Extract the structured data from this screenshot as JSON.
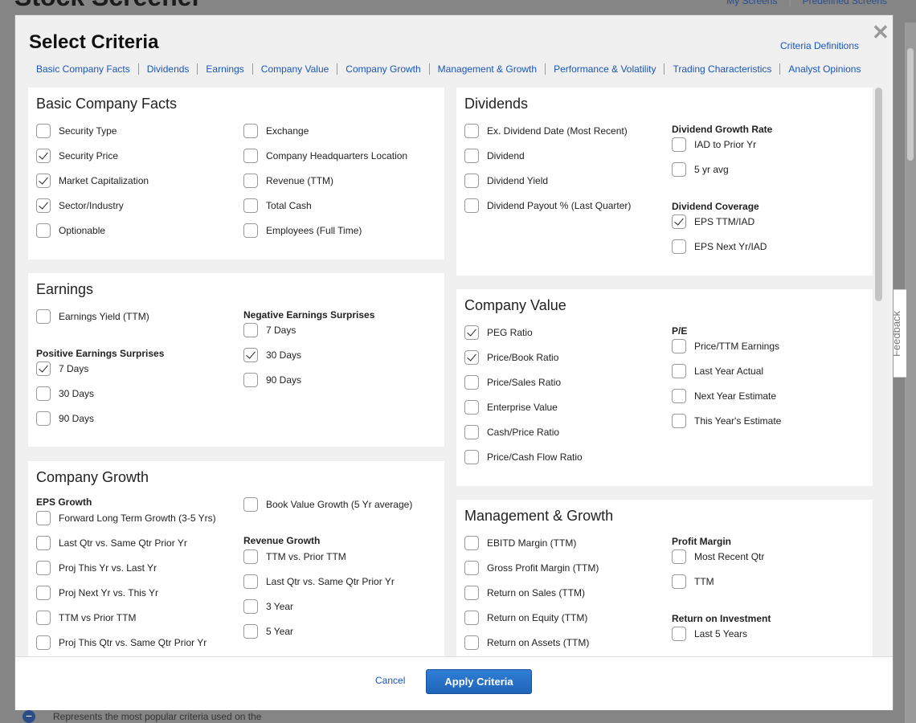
{
  "background": {
    "page_title": "Stock Screener",
    "my_screens": "My Screens",
    "predefined_screens": "Predefined Screens",
    "bottom_text": "Represents the most popular criteria used on the"
  },
  "feedback": {
    "label": "Feedback"
  },
  "modal": {
    "title": "Select Criteria",
    "close_icon": "✕",
    "criteria_definitions": "Criteria Definitions",
    "nav": [
      "Basic Company Facts",
      "Dividends",
      "Earnings",
      "Company Value",
      "Company Growth",
      "Management & Growth",
      "Performance & Volatility",
      "Trading Characteristics",
      "Analyst Opinions"
    ]
  },
  "panels": {
    "basic": {
      "title": "Basic Company Facts",
      "items": [
        {
          "label": "Security Type",
          "checked": false
        },
        {
          "label": "Security Price",
          "checked": true
        },
        {
          "label": "Market Capitalization",
          "checked": true
        },
        {
          "label": "Sector/Industry",
          "checked": true
        },
        {
          "label": "Optionable",
          "checked": false
        },
        {
          "label": "Exchange",
          "checked": false
        },
        {
          "label": "Company Headquarters Location",
          "checked": false
        },
        {
          "label": "Revenue (TTM)",
          "checked": false
        },
        {
          "label": "Total Cash",
          "checked": false
        },
        {
          "label": "Employees (Full Time)",
          "checked": false
        }
      ]
    },
    "dividends": {
      "title": "Dividends",
      "items": [
        {
          "label": "Ex. Dividend Date (Most Recent)",
          "checked": false
        },
        {
          "label": "Dividend",
          "checked": false
        },
        {
          "label": "Dividend Yield",
          "checked": false
        },
        {
          "label": "Dividend Payout % (Last Quarter)",
          "checked": false
        },
        {
          "label": "IAD to Prior Yr",
          "checked": false
        },
        {
          "label": "5 yr avg",
          "checked": false
        },
        {
          "label": "EPS TTM/IAD",
          "checked": true
        },
        {
          "label": "EPS Next Yr/IAD",
          "checked": false
        }
      ],
      "sub_growth": "Dividend Growth Rate",
      "sub_coverage": "Dividend Coverage"
    },
    "earnings": {
      "title": "Earnings",
      "items": [
        {
          "label": "Earnings Yield (TTM)",
          "checked": false
        },
        {
          "label": "7 Days",
          "checked": true
        },
        {
          "label": "30 Days",
          "checked": false
        },
        {
          "label": "90 Days",
          "checked": false
        },
        {
          "label": "7 Days",
          "checked": false
        },
        {
          "label": "30 Days",
          "checked": true
        },
        {
          "label": "90 Days",
          "checked": false
        }
      ],
      "sub_positive": "Positive Earnings Surprises",
      "sub_negative": "Negative Earnings Surprises"
    },
    "value": {
      "title": "Company Value",
      "items": [
        {
          "label": "PEG Ratio",
          "checked": true
        },
        {
          "label": "Price/Book Ratio",
          "checked": true
        },
        {
          "label": "Price/Sales Ratio",
          "checked": false
        },
        {
          "label": "Enterprise Value",
          "checked": false
        },
        {
          "label": "Cash/Price Ratio",
          "checked": false
        },
        {
          "label": "Price/Cash Flow Ratio",
          "checked": false
        },
        {
          "label": "Price/TTM Earnings",
          "checked": false
        },
        {
          "label": "Last Year Actual",
          "checked": false
        },
        {
          "label": "Next Year Estimate",
          "checked": false
        },
        {
          "label": "This Year's Estimate",
          "checked": false
        }
      ],
      "sub_pe": "P/E"
    },
    "growth": {
      "title": "Company Growth",
      "items": [
        {
          "label": "Forward Long Term Growth (3-5 Yrs)",
          "checked": false
        },
        {
          "label": "Last Qtr vs. Same Qtr Prior Yr",
          "checked": false
        },
        {
          "label": "Proj This Yr vs. Last Yr",
          "checked": false
        },
        {
          "label": "Proj Next Yr vs. This Yr",
          "checked": false
        },
        {
          "label": "TTM vs Prior TTM",
          "checked": false
        },
        {
          "label": "Proj This Qtr vs. Same Qtr Prior Yr",
          "checked": false
        },
        {
          "label": "Book Value Growth (5 Yr average)",
          "checked": false
        },
        {
          "label": "TTM vs. Prior TTM",
          "checked": false
        },
        {
          "label": "Last Qtr vs. Same Qtr Prior Yr",
          "checked": false
        },
        {
          "label": "3 Year",
          "checked": false
        },
        {
          "label": "5 Year",
          "checked": false
        }
      ],
      "sub_eps": "EPS Growth",
      "sub_revenue": "Revenue Growth"
    },
    "mgmt": {
      "title": "Management & Growth",
      "items": [
        {
          "label": "EBITD Margin (TTM)",
          "checked": false
        },
        {
          "label": "Gross Profit Margin (TTM)",
          "checked": false
        },
        {
          "label": "Return on Sales (TTM)",
          "checked": false
        },
        {
          "label": "Return on Equity (TTM)",
          "checked": false
        },
        {
          "label": "Return on Assets (TTM)",
          "checked": false
        },
        {
          "label": "Most Recent Qtr",
          "checked": false
        },
        {
          "label": "TTM",
          "checked": false
        },
        {
          "label": "Last 5 Years",
          "checked": false
        }
      ],
      "sub_profit": "Profit Margin",
      "sub_roi": "Return on Investment"
    }
  },
  "footer": {
    "cancel": "Cancel",
    "apply": "Apply Criteria"
  }
}
